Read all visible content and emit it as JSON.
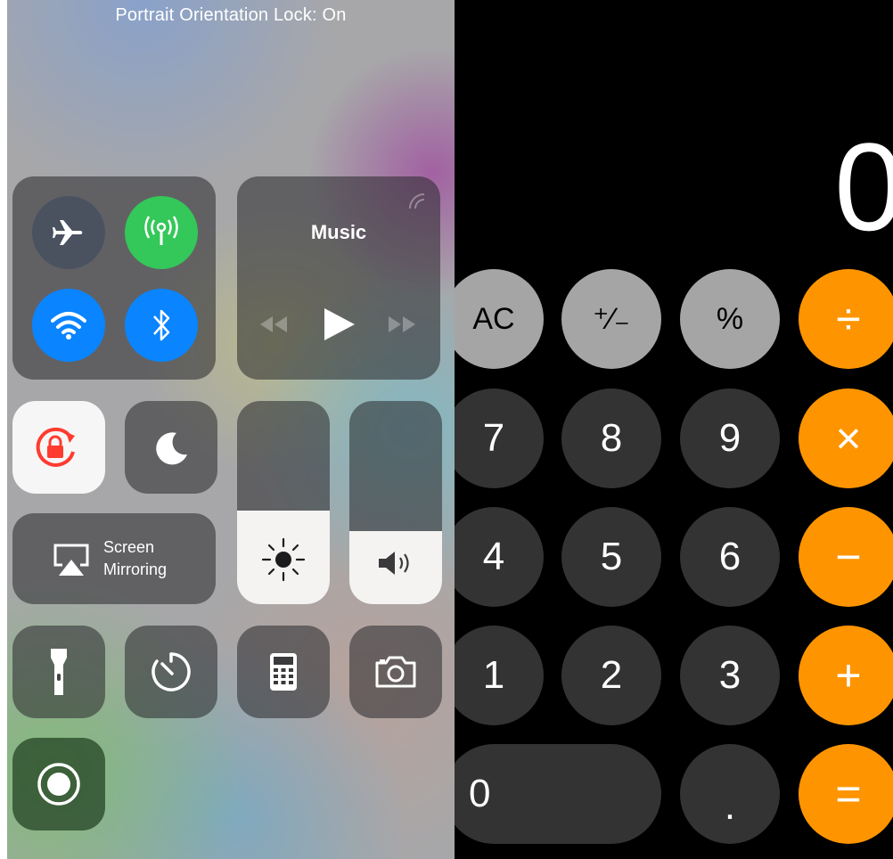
{
  "control_center": {
    "status_banner": "Portrait Orientation Lock: On",
    "connectivity": {
      "airplane_mode": {
        "icon": "airplane-icon",
        "on": false
      },
      "cellular_data": {
        "icon": "cellular-antenna-icon",
        "on": true,
        "color": "#34c759"
      },
      "wifi": {
        "icon": "wifi-icon",
        "on": true,
        "color": "#0a84ff"
      },
      "bluetooth": {
        "icon": "bluetooth-icon",
        "on": true,
        "color": "#0a84ff"
      }
    },
    "music": {
      "title": "Music",
      "controls": [
        "rewind-icon",
        "play-icon",
        "fast-forward-icon"
      ],
      "airplay_icon": "airplay-audio-icon"
    },
    "orientation_lock": {
      "icon": "orientation-lock-icon",
      "on": true,
      "color": "#ff3b30"
    },
    "do_not_disturb": {
      "icon": "moon-icon",
      "on": false
    },
    "screen_mirroring": {
      "line1": "Screen",
      "line2": "Mirroring",
      "icon": "airplay-screen-icon"
    },
    "brightness": {
      "icon": "sun-icon",
      "level": 0.46
    },
    "volume": {
      "icon": "speaker-icon",
      "level": 0.36
    },
    "shortcuts": [
      "flashlight-icon",
      "timer-icon",
      "calculator-icon",
      "camera-icon"
    ],
    "screen_recording": {
      "icon": "record-icon"
    }
  },
  "calculator": {
    "display_value": "0",
    "colors": {
      "function": "#a5a5a5",
      "digit": "#333333",
      "operator": "#fe9500"
    },
    "rows": [
      [
        {
          "label": "AC",
          "kind": "function"
        },
        {
          "label": "⁺∕₋",
          "kind": "function"
        },
        {
          "label": "%",
          "kind": "function"
        },
        {
          "label": "÷",
          "kind": "operator"
        }
      ],
      [
        {
          "label": "7",
          "kind": "digit"
        },
        {
          "label": "8",
          "kind": "digit"
        },
        {
          "label": "9",
          "kind": "digit"
        },
        {
          "label": "×",
          "kind": "operator"
        }
      ],
      [
        {
          "label": "4",
          "kind": "digit"
        },
        {
          "label": "5",
          "kind": "digit"
        },
        {
          "label": "6",
          "kind": "digit"
        },
        {
          "label": "−",
          "kind": "operator"
        }
      ],
      [
        {
          "label": "1",
          "kind": "digit"
        },
        {
          "label": "2",
          "kind": "digit"
        },
        {
          "label": "3",
          "kind": "digit"
        },
        {
          "label": "+",
          "kind": "operator"
        }
      ],
      [
        {
          "label": "0",
          "kind": "digit"
        },
        {
          "label": ".",
          "kind": "digit"
        },
        {
          "label": "=",
          "kind": "operator"
        }
      ]
    ]
  }
}
